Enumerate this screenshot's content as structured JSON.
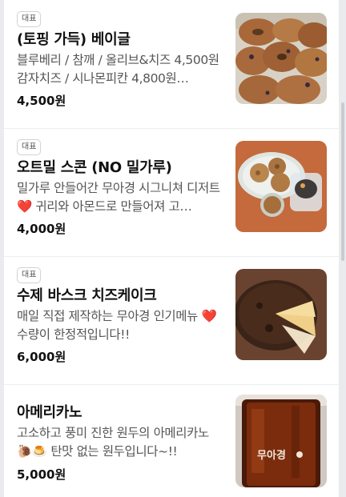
{
  "menu": {
    "items": [
      {
        "badge": "대표",
        "name": "(토핑 가득) 베이글",
        "description": "블루베리 / 참깨 / 올리브&치즈 4,500원 감자치즈 / 시나몬피칸 4,800원…",
        "price": "4,500원",
        "image": "bagel-photo"
      },
      {
        "badge": "대표",
        "name": "오트밀 스콘 (NO 밀가루)",
        "description": "밀가루 안들어간 무아경 시그니쳐 디저트❤️ 귀리와 아몬드로 만들어져 고…",
        "price": "4,000원",
        "image": "scone-photo"
      },
      {
        "badge": "대표",
        "name": "수제 바스크 치즈케이크",
        "description": "매일 직접 제작하는 무아경 인기메뉴 ❤️ 수량이 한정적입니다!!",
        "price": "6,000원",
        "image": "cheesecake-photo"
      },
      {
        "badge": "",
        "name": "아메리카노",
        "description": "고소하고 풍미 진한 원두의 아메리카노 🐌🍮 탄맛 없는 원두입니다~!!",
        "price": "5,000원",
        "image": "americano-photo",
        "cup_text": "무아경"
      }
    ]
  }
}
